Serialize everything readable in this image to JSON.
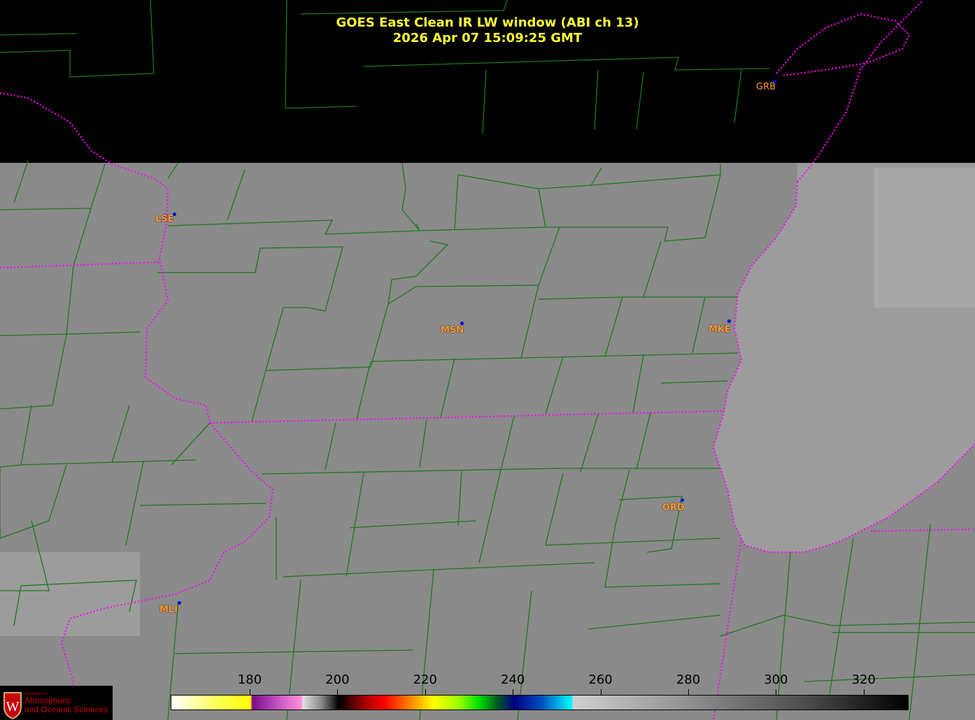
{
  "title": {
    "line1": "GOES East Clean IR LW window (ABI ch 13)",
    "line2": "2026 Apr 07  15:09:25 GMT"
  },
  "cities": [
    {
      "code": "GRB"
    },
    {
      "code": "LSE"
    },
    {
      "code": "MSN"
    },
    {
      "code": "MKE"
    },
    {
      "code": "MLI"
    },
    {
      "code": "ORD"
    }
  ],
  "colorbar": {
    "units_ticks": [
      "180",
      "200",
      "220",
      "240",
      "260",
      "280",
      "300",
      "320"
    ],
    "range": [
      162,
      330
    ]
  },
  "logo": {
    "line_small": "Department of",
    "line1": "Atmospheric",
    "line2": "and Oceanic Sciences"
  },
  "colors": {
    "title": "#ffff33",
    "county_lines": "#1a7a1a",
    "state_borders": "#ff00ff",
    "city_labels": "#ff9933",
    "city_dots": "#0000ee"
  }
}
